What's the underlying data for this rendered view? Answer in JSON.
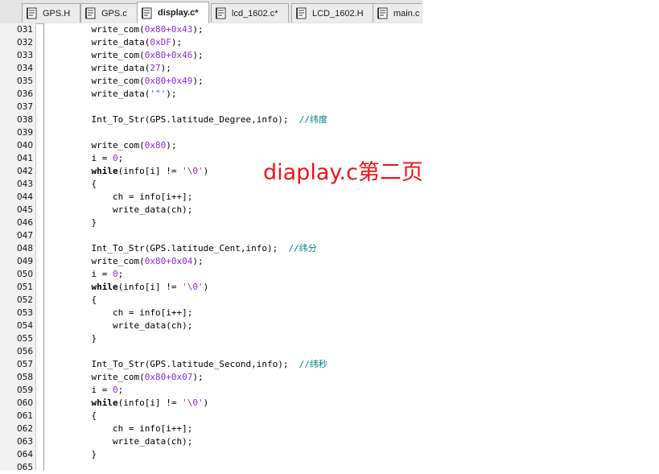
{
  "tabs": [
    {
      "label": "GPS.H",
      "active": false
    },
    {
      "label": "GPS.c",
      "active": false
    },
    {
      "label": "display.c*",
      "active": true
    },
    {
      "label": "lcd_1602.c*",
      "active": false
    },
    {
      "label": "LCD_1602.H",
      "active": false
    },
    {
      "label": "main.c",
      "active": false
    }
  ],
  "lines": [
    {
      "n": "031",
      "t": [
        [
          "    write_com(",
          ""
        ],
        [
          "0x80+0x43",
          "num"
        ],
        [
          ");",
          ""
        ]
      ]
    },
    {
      "n": "032",
      "t": [
        [
          "    write_data(",
          ""
        ],
        [
          "0xDF",
          "num"
        ],
        [
          ");",
          ""
        ]
      ]
    },
    {
      "n": "033",
      "t": [
        [
          "    write_com(",
          ""
        ],
        [
          "0x80+0x46",
          "num"
        ],
        [
          ");",
          ""
        ]
      ]
    },
    {
      "n": "034",
      "t": [
        [
          "    write_data(",
          ""
        ],
        [
          "27",
          "num"
        ],
        [
          ");",
          ""
        ]
      ]
    },
    {
      "n": "035",
      "t": [
        [
          "    write_com(",
          ""
        ],
        [
          "0x80+0x49",
          "num"
        ],
        [
          ");",
          ""
        ]
      ]
    },
    {
      "n": "036",
      "t": [
        [
          "    write_data(",
          ""
        ],
        [
          "'\"'",
          "str"
        ],
        [
          ");",
          ""
        ]
      ]
    },
    {
      "n": "037",
      "t": []
    },
    {
      "n": "038",
      "t": [
        [
          "    Int_To_Str(GPS.latitude_Degree,info);  ",
          ""
        ],
        [
          "//纬度",
          "cmt"
        ]
      ]
    },
    {
      "n": "039",
      "t": []
    },
    {
      "n": "040",
      "t": [
        [
          "    write_com(",
          ""
        ],
        [
          "0x80",
          "num"
        ],
        [
          ");",
          ""
        ]
      ]
    },
    {
      "n": "041",
      "t": [
        [
          "    i = ",
          ""
        ],
        [
          "0",
          "num"
        ],
        [
          ";",
          ""
        ]
      ]
    },
    {
      "n": "042",
      "t": [
        [
          "    ",
          ""
        ],
        [
          "while",
          "kw"
        ],
        [
          "(info[i] != ",
          ""
        ],
        [
          "'\\0'",
          "str"
        ],
        [
          ")",
          ""
        ]
      ]
    },
    {
      "n": "043",
      "t": [
        [
          "    {",
          ""
        ]
      ]
    },
    {
      "n": "044",
      "t": [
        [
          "        ch = info[i++];",
          ""
        ]
      ]
    },
    {
      "n": "045",
      "t": [
        [
          "        write_data(ch);",
          ""
        ]
      ]
    },
    {
      "n": "046",
      "t": [
        [
          "    }",
          ""
        ]
      ]
    },
    {
      "n": "047",
      "t": []
    },
    {
      "n": "048",
      "t": [
        [
          "    Int_To_Str(GPS.latitude_Cent,info);  ",
          ""
        ],
        [
          "//纬分",
          "cmt"
        ]
      ]
    },
    {
      "n": "049",
      "t": [
        [
          "    write_com(",
          ""
        ],
        [
          "0x80+0x04",
          "num"
        ],
        [
          ");",
          ""
        ]
      ]
    },
    {
      "n": "050",
      "t": [
        [
          "    i = ",
          ""
        ],
        [
          "0",
          "num"
        ],
        [
          ";",
          ""
        ]
      ]
    },
    {
      "n": "051",
      "t": [
        [
          "    ",
          ""
        ],
        [
          "while",
          "kw"
        ],
        [
          "(info[i] != ",
          ""
        ],
        [
          "'\\0'",
          "str"
        ],
        [
          ")",
          ""
        ]
      ]
    },
    {
      "n": "052",
      "t": [
        [
          "    {",
          ""
        ]
      ]
    },
    {
      "n": "053",
      "t": [
        [
          "        ch = info[i++];",
          ""
        ]
      ]
    },
    {
      "n": "054",
      "t": [
        [
          "        write_data(ch);",
          ""
        ]
      ]
    },
    {
      "n": "055",
      "t": [
        [
          "    }",
          ""
        ]
      ]
    },
    {
      "n": "056",
      "t": []
    },
    {
      "n": "057",
      "t": [
        [
          "    Int_To_Str(GPS.latitude_Second,info);  ",
          ""
        ],
        [
          "//纬秒",
          "cmt"
        ]
      ]
    },
    {
      "n": "058",
      "t": [
        [
          "    write_com(",
          ""
        ],
        [
          "0x80+0x07",
          "num"
        ],
        [
          ");",
          ""
        ]
      ]
    },
    {
      "n": "059",
      "t": [
        [
          "    i = ",
          ""
        ],
        [
          "0",
          "num"
        ],
        [
          ";",
          ""
        ]
      ]
    },
    {
      "n": "060",
      "t": [
        [
          "    ",
          ""
        ],
        [
          "while",
          "kw"
        ],
        [
          "(info[i] != ",
          ""
        ],
        [
          "'\\0'",
          "str"
        ],
        [
          ")",
          ""
        ]
      ]
    },
    {
      "n": "061",
      "t": [
        [
          "    {",
          ""
        ]
      ]
    },
    {
      "n": "062",
      "t": [
        [
          "        ch = info[i++];",
          ""
        ]
      ]
    },
    {
      "n": "063",
      "t": [
        [
          "        write_data(ch);",
          ""
        ]
      ]
    },
    {
      "n": "064",
      "t": [
        [
          "    }",
          ""
        ]
      ]
    },
    {
      "n": "065",
      "t": []
    }
  ],
  "overlay_text": "diaplay.c第二页"
}
